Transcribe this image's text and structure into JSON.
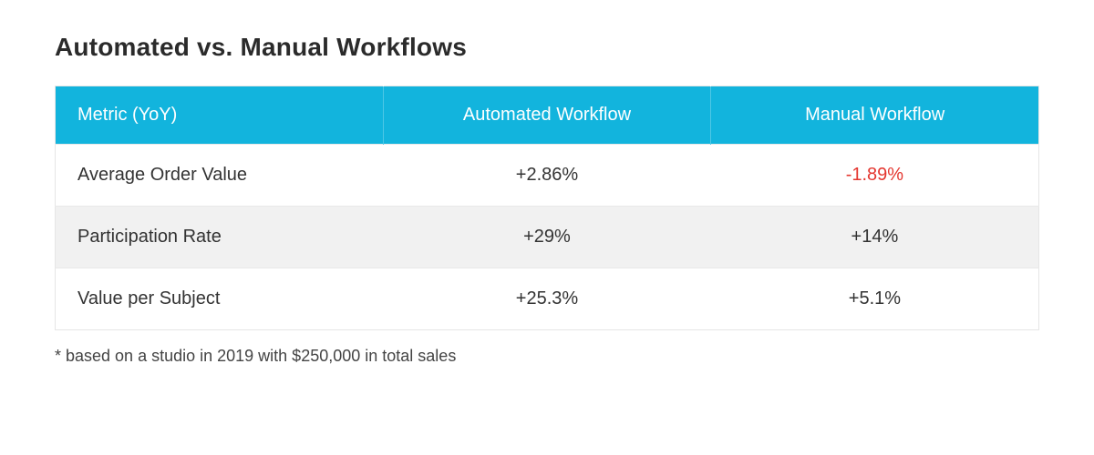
{
  "title": "Automated vs. Manual Workflows",
  "columns": [
    "Metric (YoY)",
    "Automated Workflow",
    "Manual Workflow"
  ],
  "rows": [
    {
      "metric": "Average Order Value",
      "automated": "+2.86%",
      "manual": "-1.89%",
      "manual_negative": true
    },
    {
      "metric": "Participation Rate",
      "automated": "+29%",
      "manual": "+14%",
      "manual_negative": false
    },
    {
      "metric": "Value per Subject",
      "automated": "+25.3%",
      "manual": "+5.1%",
      "manual_negative": false
    }
  ],
  "footnote": "* based on a studio in 2019 with $250,000 in total sales",
  "chart_data": {
    "type": "table",
    "title": "Automated vs. Manual Workflows",
    "categories": [
      "Average Order Value",
      "Participation Rate",
      "Value per Subject"
    ],
    "series": [
      {
        "name": "Automated Workflow",
        "values": [
          2.86,
          29,
          25.3
        ],
        "unit": "percent_change_yoy"
      },
      {
        "name": "Manual Workflow",
        "values": [
          -1.89,
          14,
          5.1
        ],
        "unit": "percent_change_yoy"
      }
    ],
    "footnote": "* based on a studio in 2019 with $250,000 in total sales"
  }
}
